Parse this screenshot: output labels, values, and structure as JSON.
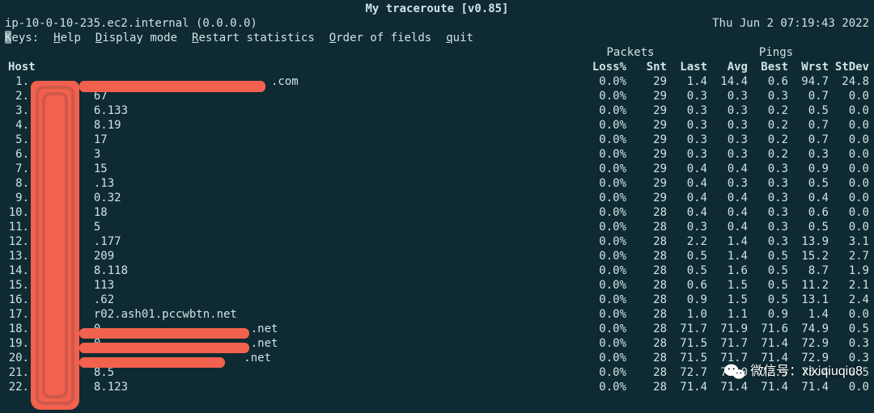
{
  "title": "My traceroute  [v0.85]",
  "internal": "ip-10-0-10-235.ec2.internal (0.0.0.0)",
  "timestamp": "Thu Jun  2 07:19:43 2022",
  "menu": {
    "keys": "Keys:",
    "items": [
      {
        "key": "H",
        "rest": "elp"
      },
      {
        "key": "D",
        "rest": "isplay mode"
      },
      {
        "key": "R",
        "rest": "estart statistics"
      },
      {
        "key": "O",
        "rest": "rder of fields"
      },
      {
        "key": "q",
        "rest": "uit"
      }
    ]
  },
  "group": {
    "packets": "Packets",
    "pings": "Pings"
  },
  "cols": {
    "host": "Host",
    "loss": "Loss%",
    "snt": "Snt",
    "last": "Last",
    "avg": "Avg",
    "best": "Best",
    "wrst": "Wrst",
    "stdev": "StDev"
  },
  "hops": [
    {
      "n": 1,
      "host": "                                   .com",
      "loss": "0.0%",
      "snt": "29",
      "last": "1.4",
      "avg": "14.4",
      "best": "0.6",
      "wrst": "94.7",
      "stdev": "24.8"
    },
    {
      "n": 2,
      "host": "         67",
      "loss": "0.0%",
      "snt": "29",
      "last": "0.3",
      "avg": "0.3",
      "best": "0.3",
      "wrst": "0.7",
      "stdev": "0.0"
    },
    {
      "n": 3,
      "host": "         6.133",
      "loss": "0.0%",
      "snt": "29",
      "last": "0.3",
      "avg": "0.3",
      "best": "0.2",
      "wrst": "0.5",
      "stdev": "0.0"
    },
    {
      "n": 4,
      "host": "         8.19",
      "loss": "0.0%",
      "snt": "29",
      "last": "0.3",
      "avg": "0.3",
      "best": "0.2",
      "wrst": "0.7",
      "stdev": "0.0"
    },
    {
      "n": 5,
      "host": "         17",
      "loss": "0.0%",
      "snt": "29",
      "last": "0.3",
      "avg": "0.3",
      "best": "0.2",
      "wrst": "0.7",
      "stdev": "0.0"
    },
    {
      "n": 6,
      "host": "         3",
      "loss": "0.0%",
      "snt": "29",
      "last": "0.3",
      "avg": "0.3",
      "best": "0.2",
      "wrst": "0.3",
      "stdev": "0.0"
    },
    {
      "n": 7,
      "host": "         15",
      "loss": "0.0%",
      "snt": "29",
      "last": "0.4",
      "avg": "0.4",
      "best": "0.3",
      "wrst": "0.9",
      "stdev": "0.0"
    },
    {
      "n": 8,
      "host": "         .13",
      "loss": "0.0%",
      "snt": "29",
      "last": "0.4",
      "avg": "0.3",
      "best": "0.3",
      "wrst": "0.5",
      "stdev": "0.0"
    },
    {
      "n": 9,
      "host": "         0.32",
      "loss": "0.0%",
      "snt": "29",
      "last": "0.4",
      "avg": "0.4",
      "best": "0.3",
      "wrst": "0.4",
      "stdev": "0.0"
    },
    {
      "n": 10,
      "host": "         18",
      "loss": "0.0%",
      "snt": "28",
      "last": "0.4",
      "avg": "0.4",
      "best": "0.3",
      "wrst": "0.6",
      "stdev": "0.0"
    },
    {
      "n": 11,
      "host": "         5",
      "loss": "0.0%",
      "snt": "28",
      "last": "0.3",
      "avg": "0.4",
      "best": "0.3",
      "wrst": "0.5",
      "stdev": "0.0"
    },
    {
      "n": 12,
      "host": "         .177",
      "loss": "0.0%",
      "snt": "28",
      "last": "2.2",
      "avg": "1.4",
      "best": "0.3",
      "wrst": "13.9",
      "stdev": "3.1"
    },
    {
      "n": 13,
      "host": "         209",
      "loss": "0.0%",
      "snt": "28",
      "last": "0.5",
      "avg": "1.4",
      "best": "0.5",
      "wrst": "15.2",
      "stdev": "2.7"
    },
    {
      "n": 14,
      "host": "         8.118",
      "loss": "0.0%",
      "snt": "28",
      "last": "0.5",
      "avg": "1.6",
      "best": "0.5",
      "wrst": "8.7",
      "stdev": "1.9"
    },
    {
      "n": 15,
      "host": "         113",
      "loss": "0.0%",
      "snt": "28",
      "last": "0.6",
      "avg": "1.5",
      "best": "0.5",
      "wrst": "11.2",
      "stdev": "2.1"
    },
    {
      "n": 16,
      "host": "         .62",
      "loss": "0.0%",
      "snt": "28",
      "last": "0.9",
      "avg": "1.5",
      "best": "0.5",
      "wrst": "13.1",
      "stdev": "2.4"
    },
    {
      "n": 17,
      "host": "         r02.ash01.pccwbtn.net",
      "loss": "0.0%",
      "snt": "28",
      "last": "1.0",
      "avg": "1.1",
      "best": "0.9",
      "wrst": "1.4",
      "stdev": "0.0"
    },
    {
      "n": 18,
      "host": "         0                      .net",
      "loss": "0.0%",
      "snt": "28",
      "last": "71.7",
      "avg": "71.9",
      "best": "71.6",
      "wrst": "74.9",
      "stdev": "0.5"
    },
    {
      "n": 19,
      "host": "         0                      .net",
      "loss": "0.0%",
      "snt": "28",
      "last": "71.5",
      "avg": "71.7",
      "best": "71.4",
      "wrst": "72.9",
      "stdev": "0.3"
    },
    {
      "n": 20,
      "host": "                               .net",
      "loss": "0.0%",
      "snt": "28",
      "last": "71.5",
      "avg": "71.7",
      "best": "71.4",
      "wrst": "72.9",
      "stdev": "0.3"
    },
    {
      "n": 21,
      "host": "         8.5",
      "loss": "0.0%",
      "snt": "28",
      "last": "72.7",
      "avg": "73.0",
      "best": "72.5",
      "wrst": "75.4",
      "stdev": "0.5"
    },
    {
      "n": 22,
      "host": "         8.123",
      "loss": "0.0%",
      "snt": "28",
      "last": "71.4",
      "avg": "71.4",
      "best": "71.4",
      "wrst": "71.4",
      "stdev": "0.0"
    }
  ],
  "watermark": "微信号：xixiqiuqiu8"
}
